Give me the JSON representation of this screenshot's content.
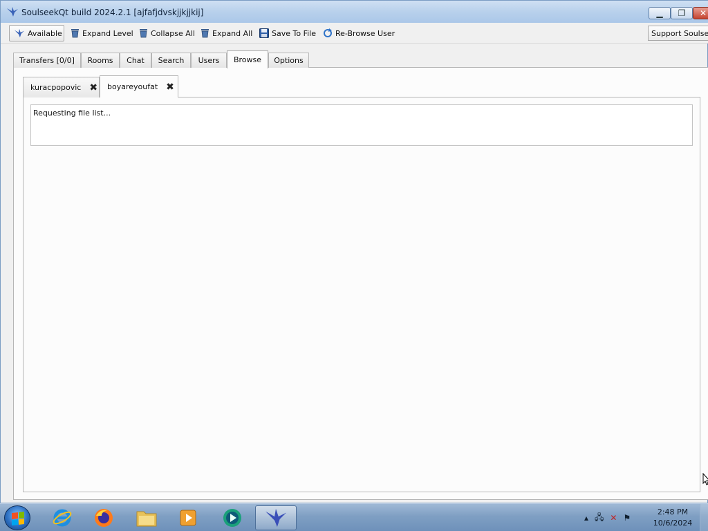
{
  "window": {
    "title": "SoulseekQt build 2024.2.1 [ajfafjdvskjjkjjkij]"
  },
  "toolbar": {
    "available_label": "Available",
    "expand_level_label": "Expand Level",
    "collapse_all_label": "Collapse All",
    "expand_all_label": "Expand All",
    "save_to_file_label": "Save To File",
    "rebrowse_user_label": "Re-Browse User",
    "support_label": "Support Soulseek"
  },
  "main_tabs": {
    "transfers": "Transfers [0/0]",
    "rooms": "Rooms",
    "chat": "Chat",
    "search": "Search",
    "users": "Users",
    "browse": "Browse",
    "options": "Options",
    "active": "Browse"
  },
  "browse_tabs": {
    "tab1": "kuracpopovic",
    "tab2": "boyareyoufat",
    "active": "boyareyoufat",
    "close_glyph": "✖"
  },
  "browse_panel": {
    "status_text": "Requesting file list..."
  },
  "taskbar": {
    "apps": [
      "internet-explorer",
      "firefox",
      "file-explorer",
      "media-player",
      "media-app",
      "soulseek"
    ],
    "active_app": "soulseek",
    "tray_icons": [
      "show-hidden-icons",
      "network-icon",
      "volume-muted-icon",
      "action-center-flag-icon"
    ],
    "time": "2:48 PM",
    "date": "10/6/2024"
  },
  "colors": {
    "accent": "#3a63b8",
    "window_bg": "#f0f0f0",
    "panel_bg": "#fcfcfc"
  }
}
